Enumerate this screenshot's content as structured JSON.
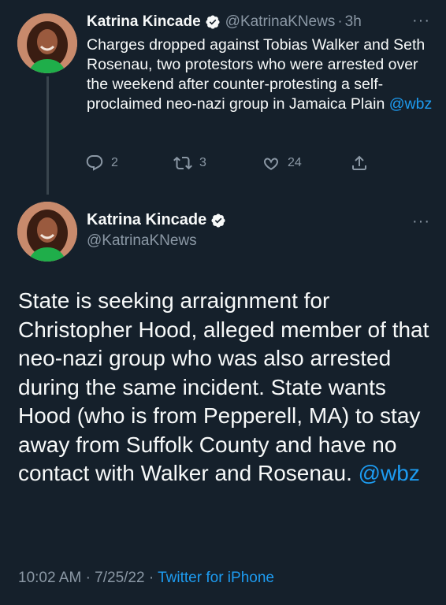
{
  "tweet1": {
    "author_name": "Katrina Kincade",
    "handle": "@KatrinaKNews",
    "separator": "·",
    "time": "3h",
    "more": "···",
    "text": "Charges dropped against Tobias Walker and Seth Rosenau, two protestors who were arrested over the weekend after counter-protesting a self-proclaimed neo-nazi group in Jamaica Plain ",
    "mention": "@wbz",
    "replies": "2",
    "retweets": "3",
    "likes": "24"
  },
  "tweet2": {
    "author_name": "Katrina Kincade",
    "handle": "@KatrinaKNews",
    "more": "···",
    "text": "State is seeking arraignment for Christopher Hood, alleged member of that neo-nazi group who was also arrested during the same incident. State wants Hood (who is from Pepperell, MA) to stay away from Suffolk County and have no contact with Walker and Rosenau. ",
    "mention": "@wbz",
    "time": "10:02 AM",
    "date": "7/25/22",
    "separator": "·",
    "source": "Twitter for iPhone"
  },
  "colors": {
    "background": "#15202b",
    "text": "#f7f9f9",
    "secondary": "#8b98a5",
    "link": "#1d9bf0",
    "thread_line": "#38444d"
  },
  "icons": {
    "verified": "verified-badge-icon",
    "reply": "reply-icon",
    "retweet": "retweet-icon",
    "like": "heart-icon",
    "share": "share-icon"
  }
}
